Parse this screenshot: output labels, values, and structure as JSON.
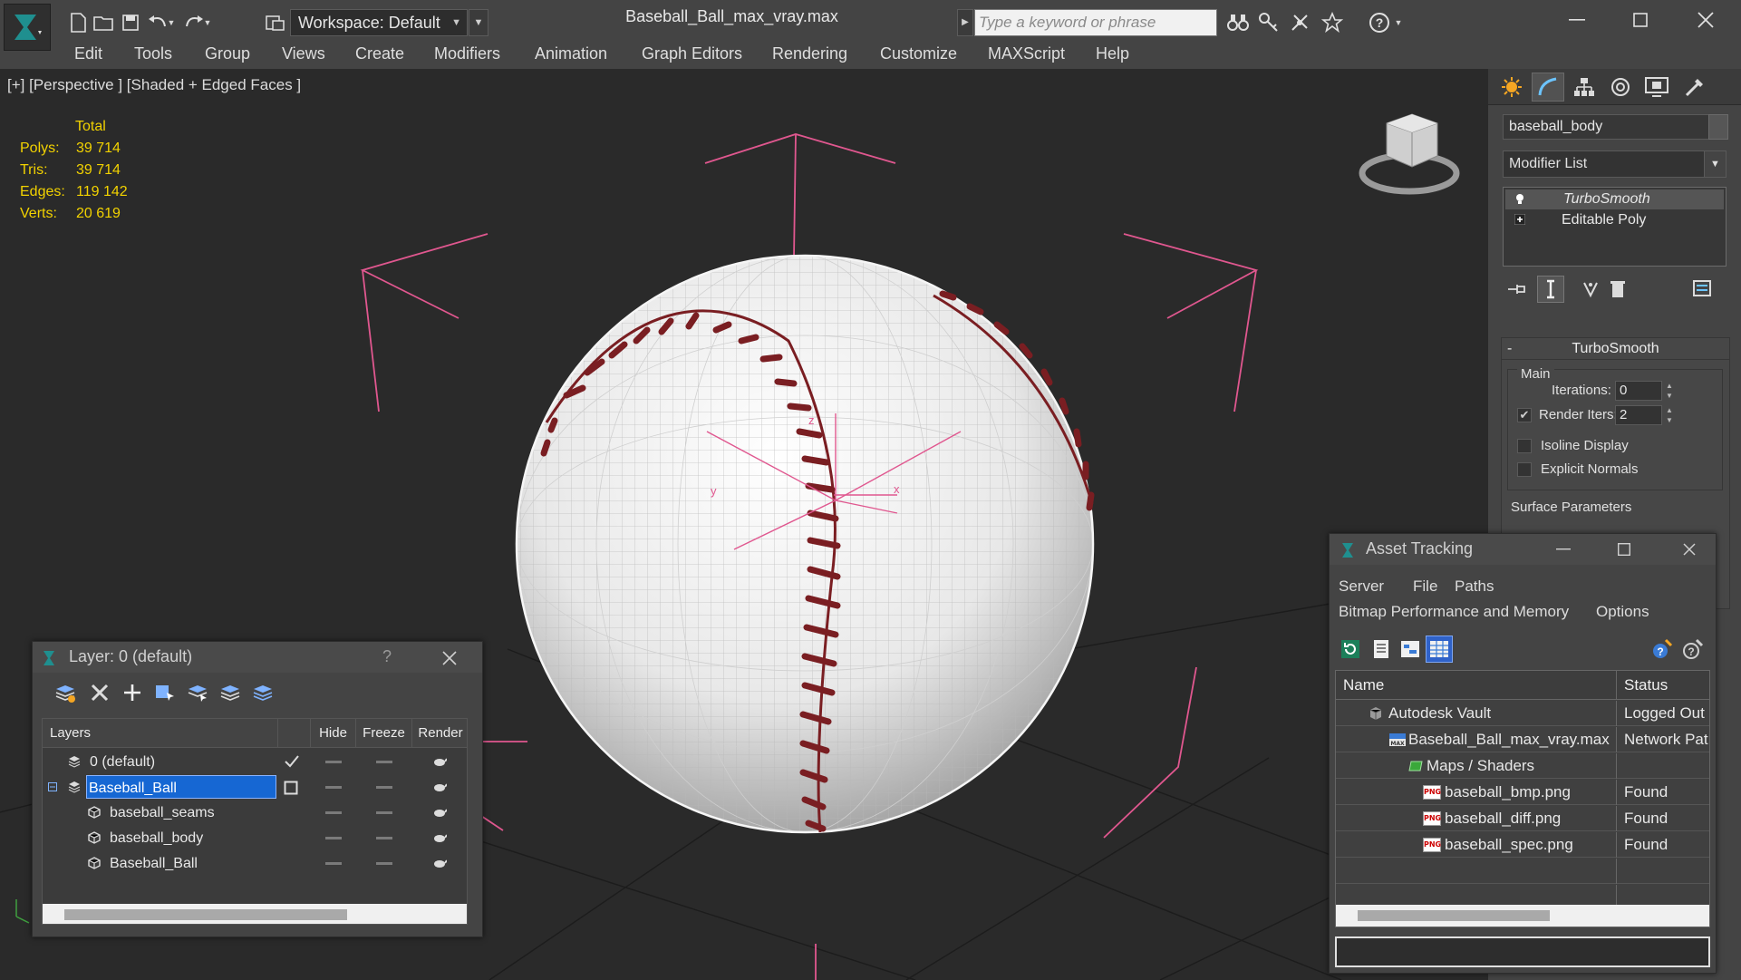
{
  "app": {
    "window_title": "Baseball_Ball_max_vray.max",
    "workspace_label": "Workspace: Default",
    "search_placeholder": "Type a keyword or phrase"
  },
  "menu": [
    "Edit",
    "Tools",
    "Group",
    "Views",
    "Create",
    "Modifiers",
    "Animation",
    "Graph Editors",
    "Rendering",
    "Customize",
    "MAXScript",
    "Help"
  ],
  "viewport": {
    "label": "[+] [Perspective ] [Shaded + Edged Faces ]",
    "stats_header": "Total",
    "stats": [
      {
        "label": "Polys:",
        "value": "39 714"
      },
      {
        "label": "Tris:",
        "value": "39 714"
      },
      {
        "label": "Edges:",
        "value": "119 142"
      },
      {
        "label": "Verts:",
        "value": "20 619"
      }
    ],
    "axis_labels": {
      "z": "z",
      "y": "y",
      "x": "x"
    }
  },
  "command_panel": {
    "object_name": "baseball_body",
    "modifier_list": "Modifier List",
    "stack": [
      "TurboSmooth",
      "Editable Poly"
    ],
    "rollout_title": "TurboSmooth",
    "main_group": "Main",
    "iterations_label": "Iterations:",
    "iterations_value": "0",
    "render_iters_label": "Render Iters:",
    "render_iters_value": "2",
    "render_iters_checked": true,
    "isoline_label": "Isoline Display",
    "isoline_checked": false,
    "explicit_normals_label": "Explicit Normals",
    "explicit_normals_checked": false,
    "surface_params_label": "Surface Parameters"
  },
  "layer_dialog": {
    "title": "Layer: 0 (default)",
    "help": "?",
    "columns": {
      "layers": "Layers",
      "hide": "Hide",
      "freeze": "Freeze",
      "render": "Render"
    },
    "rows": [
      {
        "name": "0 (default)",
        "type": "layer",
        "active": true
      },
      {
        "name": "Baseball_Ball",
        "type": "layer",
        "selected": true
      },
      {
        "name": "baseball_seams",
        "type": "object"
      },
      {
        "name": "baseball_body",
        "type": "object"
      },
      {
        "name": "Baseball_Ball",
        "type": "object"
      }
    ]
  },
  "asset_dialog": {
    "title": "Asset Tracking",
    "menu_row1": [
      "Server",
      "File",
      "Paths"
    ],
    "menu_row2": [
      "Bitmap Performance and Memory",
      "Options"
    ],
    "columns": {
      "name": "Name",
      "status": "Status"
    },
    "rows": [
      {
        "name": "Autodesk Vault",
        "status": "Logged Out",
        "icon": "vault-icon",
        "indent": 1
      },
      {
        "name": "Baseball_Ball_max_vray.max",
        "status": "Network Pat",
        "icon": "max-file-icon",
        "indent": 2
      },
      {
        "name": "Maps / Shaders",
        "status": "",
        "icon": "maps-icon",
        "indent": 3
      },
      {
        "name": "baseball_bmp.png",
        "status": "Found",
        "icon": "png-icon",
        "indent": 4
      },
      {
        "name": "baseball_diff.png",
        "status": "Found",
        "icon": "png-icon",
        "indent": 4
      },
      {
        "name": "baseball_spec.png",
        "status": "Found",
        "icon": "png-icon",
        "indent": 4
      }
    ]
  },
  "colors": {
    "selection_blue": "#1667d3",
    "stats_yellow": "#f2d200",
    "bounding_box_pink": "#e0578f",
    "seam_red": "#7a1e22"
  }
}
